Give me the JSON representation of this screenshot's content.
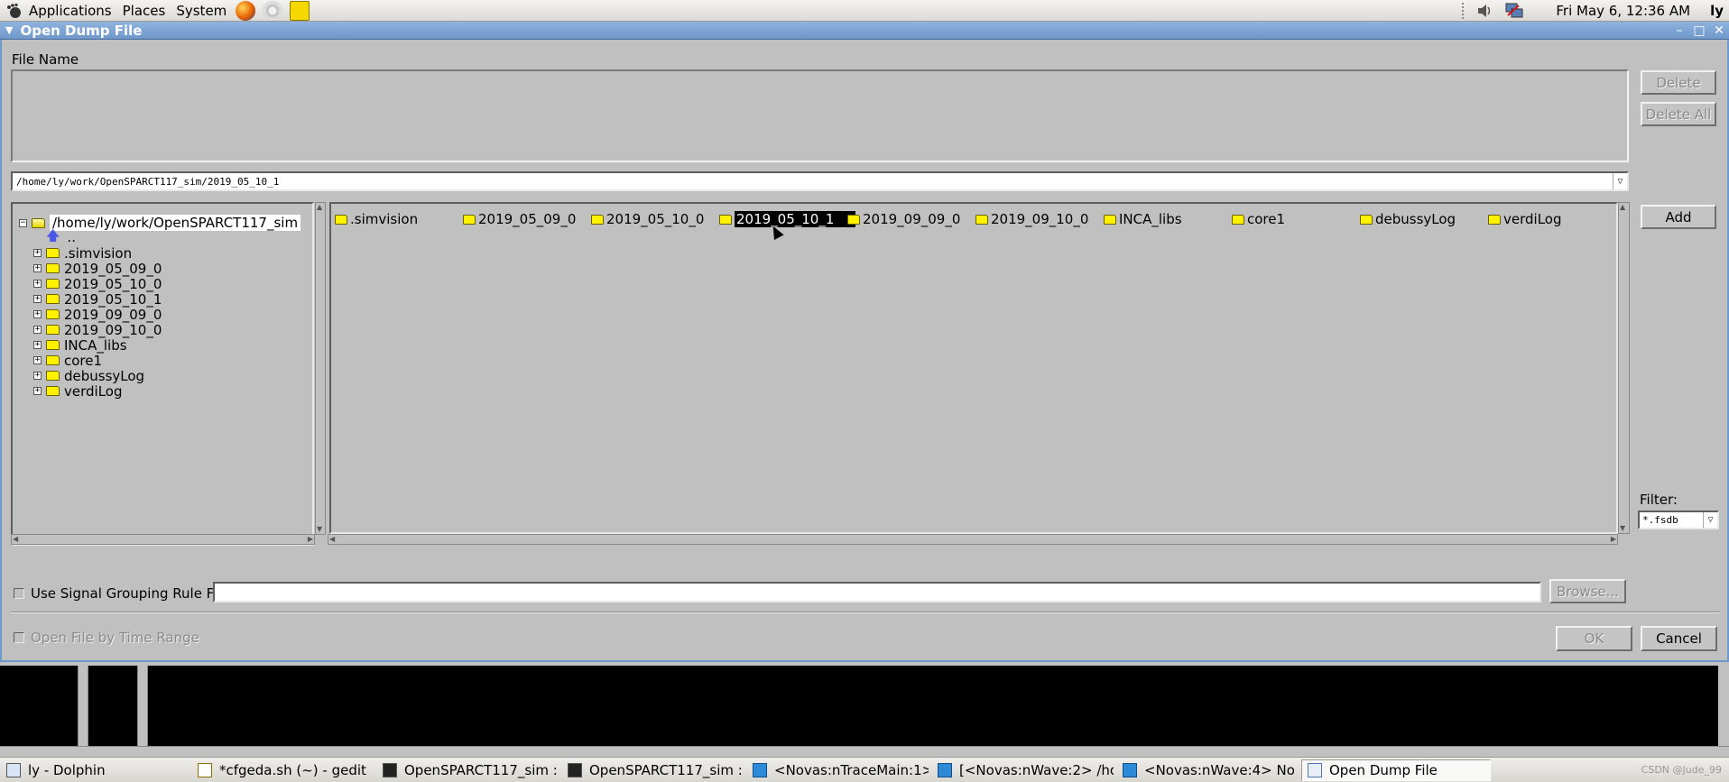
{
  "top_panel": {
    "menus": [
      "Applications",
      "Places",
      "System"
    ],
    "clock": "Fri May  6, 12:36 AM",
    "user": "ly"
  },
  "dialog": {
    "title": "Open Dump File",
    "file_name_label": "File Name",
    "buttons": {
      "delete": "Delete",
      "delete_all": "Delete All",
      "add": "Add",
      "browse": "Browse...",
      "ok": "OK",
      "cancel": "Cancel"
    },
    "current_path": "/home/ly/work/OpenSPARCT117_sim/2019_05_10_1",
    "tree": {
      "root": "/home/ly/work/OpenSPARCT117_sim",
      "parent": "..",
      "items": [
        ".simvision",
        "2019_05_09_0",
        "2019_05_10_0",
        "2019_05_10_1",
        "2019_09_09_0",
        "2019_09_10_0",
        "INCA_libs",
        "core1",
        "debussyLog",
        "verdiLog"
      ]
    },
    "file_list": {
      "items": [
        ".simvision",
        "2019_05_09_0",
        "2019_05_10_0",
        "2019_05_10_1",
        "2019_09_09_0",
        "2019_09_10_0",
        "INCA_libs",
        "core1",
        "debussyLog",
        "verdiLog"
      ],
      "selected": "2019_05_10_1"
    },
    "filter_label": "Filter:",
    "filter_value": "*.fsdb",
    "use_grouping_label": "Use Signal Grouping Rule File:",
    "time_range_label": "Open File by Time Range"
  },
  "taskbar": {
    "tasks": [
      "ly - Dolphin",
      "*cfgeda.sh (~) - gedit",
      "OpenSPARCT117_sim :...",
      "OpenSPARCT117_sim :...",
      "<Novas:nTraceMain:1>",
      "[<Novas:nWave:2> /ho...",
      "<Novas:nWave:4> No ...",
      "Open Dump File"
    ],
    "watermark": "CSDN @Jude_99"
  },
  "colors": {
    "dialog_title_bar": "#6f98cb",
    "window_background": "#c0c0c0",
    "selection": "#000000",
    "folder": "#fff100"
  }
}
